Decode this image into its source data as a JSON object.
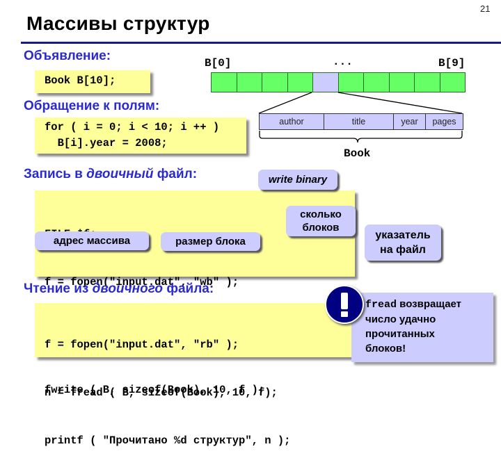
{
  "slide": {
    "page_number": "21",
    "title": "Массивы структур"
  },
  "declaration": {
    "heading": "Объявление:",
    "code": "Book B[10];"
  },
  "array_diagram": {
    "first_label": "B[0]",
    "ellipsis": "...",
    "last_label": "B[9]",
    "cell_count": 10,
    "selected_index": 4,
    "colors": {
      "cell": "#66ff66",
      "selected": "#ccccff"
    },
    "fields": [
      "author",
      "title",
      "year",
      "pages"
    ],
    "struct_label": "Book"
  },
  "field_access": {
    "heading": "Обращение к полям:",
    "code_lines": [
      "for ( i = 0; i < 10; i ++ )",
      "  B[i].year = 2008;"
    ]
  },
  "write_binary": {
    "heading_pre": "Запись в ",
    "heading_italic": "двоичный",
    "heading_post": " файл:",
    "code_lines": [
      "FILE *f;",
      "f = fopen(\"input.dat\", \"wb\" );",
      "fwrite ( B, sizeof(Book), 10, f );"
    ],
    "callouts": {
      "mode": "write binary",
      "count_line1": "сколько",
      "count_line2": "блоков",
      "address": "адрес массива",
      "size": "размер блока",
      "pointer_line1": "указатель",
      "pointer_line2": "на файл"
    }
  },
  "read_binary": {
    "heading_pre": "Чтение из ",
    "heading_italic": "двоичного",
    "heading_post": " файла:",
    "code_lines": [
      "f = fopen(\"input.dat\", \"rb\" );",
      "n = fread ( B, sizeof(Book), 10, f);",
      "printf ( \"Прочитано %d структур\", n );"
    ]
  },
  "note": {
    "icon": "exclamation-icon",
    "code_word": "fread",
    "line1_rest": " возвращает",
    "line2": "число удачно",
    "line3": "прочитанных",
    "line4": "блоков!"
  },
  "colors": {
    "heading": "#2a2ad0",
    "code_bg": "#ffff99",
    "callout_bg": "#ccccff",
    "icon_bg": "#000080"
  }
}
